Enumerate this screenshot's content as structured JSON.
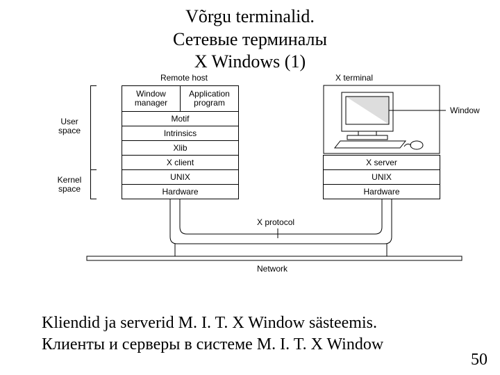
{
  "title": {
    "line1": "Võrgu terminalid.",
    "line2": "Сетевые терминалы",
    "line3": "X Windows (1)"
  },
  "labels": {
    "remote_host": "Remote host",
    "x_terminal": "X terminal",
    "window_manager": "Window\nmanager",
    "application_program": "Application\nprogram",
    "motif": "Motif",
    "intrinsics": "Intrinsics",
    "xlib": "Xlib",
    "x_client": "X client",
    "unix": "UNIX",
    "hardware": "Hardware",
    "x_server": "X server",
    "user_space": "User\nspace",
    "kernel_space": "Kernel\nspace",
    "window": "Window",
    "x_protocol": "X protocol",
    "network": "Network"
  },
  "caption": {
    "line1": "Kliendid ja serverid M. I. T. X Window  sästeemis.",
    "line2": "Клиенты и серверы в системе M. I. T. X Window"
  },
  "page": "50"
}
